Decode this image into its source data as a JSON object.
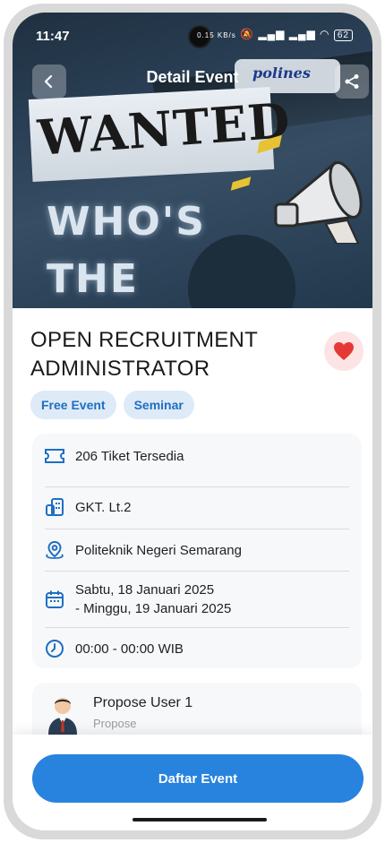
{
  "status_bar": {
    "time": "11:47",
    "data_rate": "0.15 KB/s",
    "battery": "62"
  },
  "header": {
    "title": "Detail Event"
  },
  "hero": {
    "logo": "polines",
    "wanted_text": "WANTED",
    "line1": "WHO'S",
    "line2": "THE"
  },
  "event": {
    "title": "OPEN RECRUITMENT ADMINISTRATOR",
    "tags": [
      "Free Event",
      "Seminar"
    ],
    "details": {
      "tickets": "206 Tiket Tersedia",
      "room": "GKT. Lt.2",
      "place": "Politeknik Negeri Semarang",
      "date": "Sabtu, 18 Januari 2025\n- Minggu, 19 Januari 2025",
      "date_line1": "Sabtu, 18 Januari 2025",
      "date_line2": "- Minggu, 19 Januari 2025",
      "time": "00:00 - 00:00 WIB"
    }
  },
  "proposer": {
    "name": "Propose User 1",
    "role": "Propose"
  },
  "cta": {
    "label": "Daftar Event"
  },
  "colors": {
    "accent": "#2883de",
    "chip_bg": "#deeaf7",
    "chip_text": "#1f6fc0",
    "heart": "#e53935"
  }
}
